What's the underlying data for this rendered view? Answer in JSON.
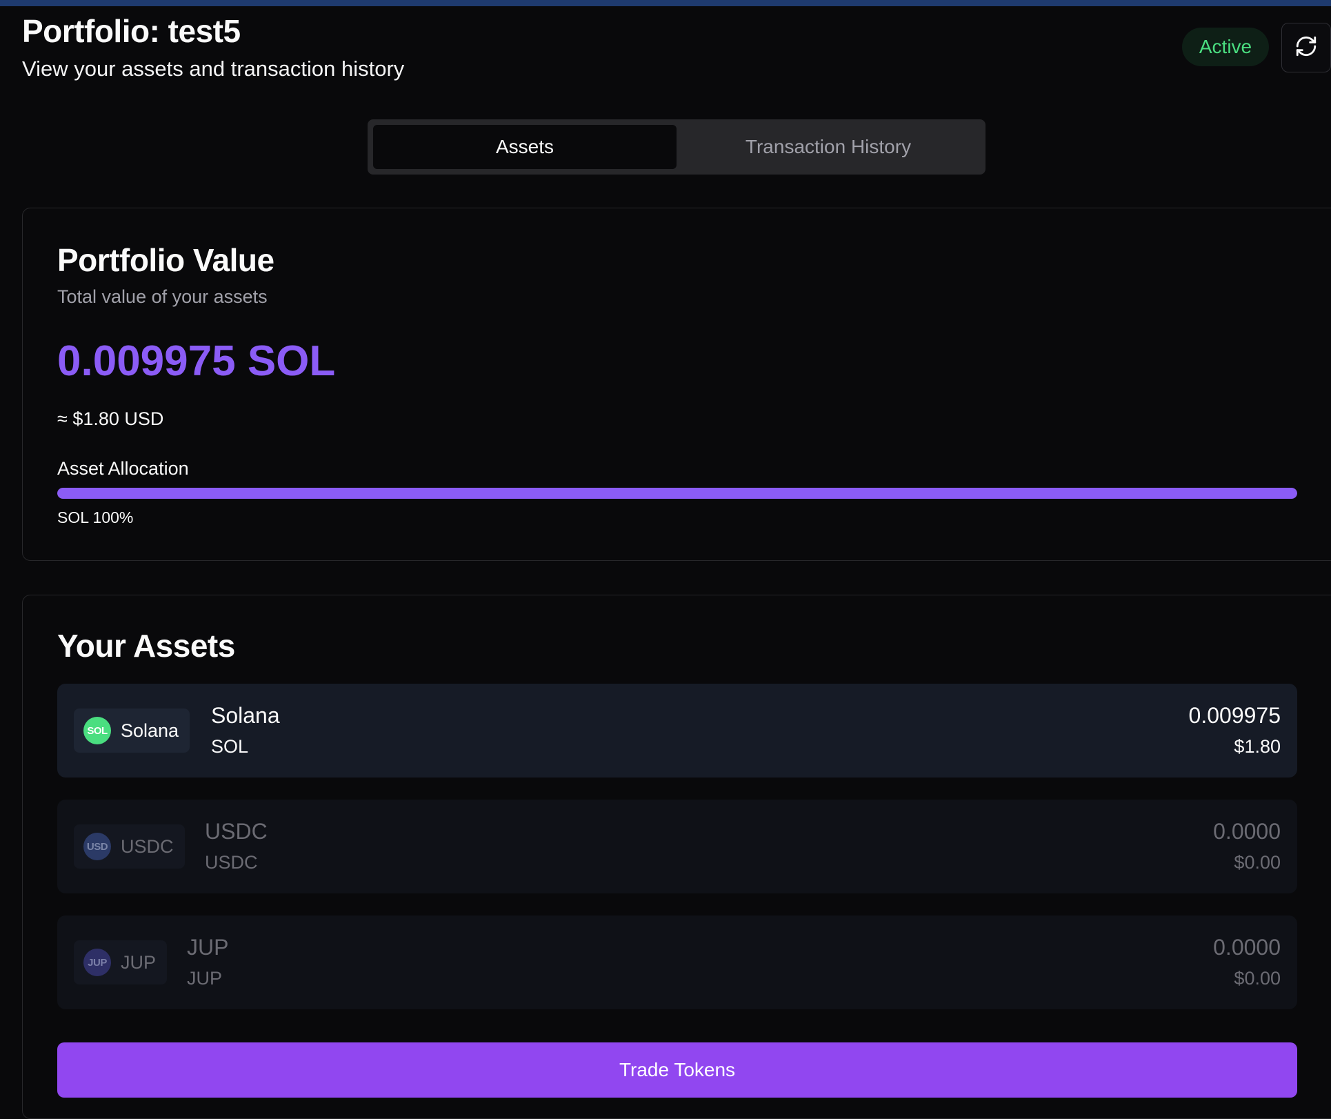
{
  "header": {
    "title": "Portfolio: test5",
    "subtitle": "View your assets and transaction history",
    "status": "Active",
    "status_color": "#4ade80"
  },
  "tabs": [
    {
      "label": "Assets",
      "active": true
    },
    {
      "label": "Transaction History",
      "active": false
    }
  ],
  "portfolio_value": {
    "title": "Portfolio Value",
    "description": "Total value of your assets",
    "value": "0.009975 SOL",
    "usd": "≈ $1.80 USD",
    "accent_color": "#8b5cf6",
    "allocation_label": "Asset Allocation",
    "allocation": [
      {
        "symbol": "SOL",
        "percent": 100,
        "legend": "SOL 100%"
      }
    ]
  },
  "assets": {
    "title": "Your Assets",
    "items": [
      {
        "icon_text": "SOL",
        "chip_label": "Solana",
        "name": "Solana",
        "symbol": "SOL",
        "amount": "0.009975",
        "usd": "$1.80",
        "icon_color": "#4ade80"
      },
      {
        "icon_text": "USD",
        "chip_label": "USDC",
        "name": "USDC",
        "symbol": "USDC",
        "amount": "0.0000",
        "usd": "$0.00",
        "icon_color": "#2b3a66"
      },
      {
        "icon_text": "JUP",
        "chip_label": "JUP",
        "name": "JUP",
        "symbol": "JUP",
        "amount": "0.0000",
        "usd": "$0.00",
        "icon_color": "#2e2f66"
      }
    ],
    "trade_button": "Trade Tokens",
    "button_color": "#9147f0"
  }
}
